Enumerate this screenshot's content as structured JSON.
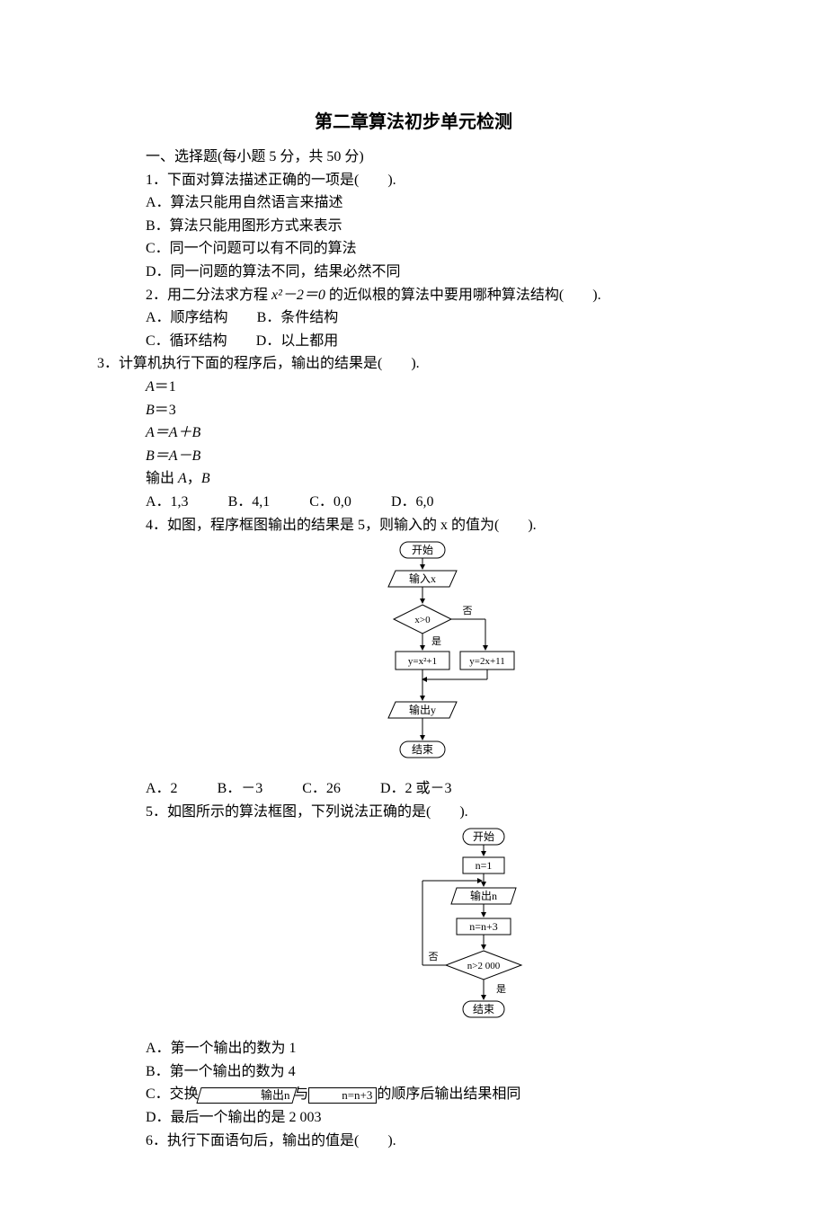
{
  "title": "第二章算法初步单元检测",
  "section1_header": "一、选择题(每小题 5 分，共 50 分)",
  "q1": {
    "stem": "1．下面对算法描述正确的一项是(　　).",
    "A": "A．算法只能用自然语言来描述",
    "B": "B．算法只能用图形方式来表示",
    "C": "C．同一个问题可以有不同的算法",
    "D": "D．同一问题的算法不同，结果必然不同"
  },
  "q2": {
    "stem_pre": "2．用二分法求方程 ",
    "stem_math": "x²－2＝0",
    "stem_post": " 的近似根的算法中要用哪种算法结构(　　).",
    "A": "A．顺序结构",
    "B": "B．条件结构",
    "C": "C．循环结构",
    "D": "D．以上都用"
  },
  "q3": {
    "stem": "3．计算机执行下面的程序后，输出的结果是(　　).",
    "code": {
      "l1_a": "A",
      "l1_eq": "＝1",
      "l2_a": "B",
      "l2_eq": "＝3",
      "l3": "A＝A＋B",
      "l4": "B＝A－B",
      "l5_pre": "输出 ",
      "l5_a": "A",
      "l5_mid": "，",
      "l5_b": "B"
    },
    "A": "A．1,3",
    "B": "B．4,1",
    "C": "C．0,0",
    "D": "D．6,0"
  },
  "q4": {
    "stem": "4．如图，程序框图输出的结果是 5，则输入的 x 的值为(　　).",
    "flow": {
      "start": "开始",
      "input": "输入x",
      "cond": "x>0",
      "yes": "是",
      "no": "否",
      "left": "y=x²+1",
      "right": "y=2x+11",
      "output": "输出y",
      "end": "结束"
    },
    "A": "A．2",
    "B": "B．－3",
    "C": "C．26",
    "D": "D．2 或－3"
  },
  "q5": {
    "stem": "5．如图所示的算法框图，下列说法正确的是(　　).",
    "flow": {
      "start": "开始",
      "init": "n=1",
      "output": "输出n",
      "step": "n=n+3",
      "cond": "n>2 000",
      "yes": "是",
      "no": "否",
      "end": "结束"
    },
    "A": "A．第一个输出的数为 1",
    "B": "B．第一个输出的数为 4",
    "C_pre": "C．交换",
    "C_box1": "输出n",
    "C_mid": "与",
    "C_box2": "n=n+3",
    "C_post": "的顺序后输出结果相同",
    "D": "D．最后一个输出的是 2 003"
  },
  "q6": {
    "stem": "6．执行下面语句后，输出的值是(　　)."
  }
}
